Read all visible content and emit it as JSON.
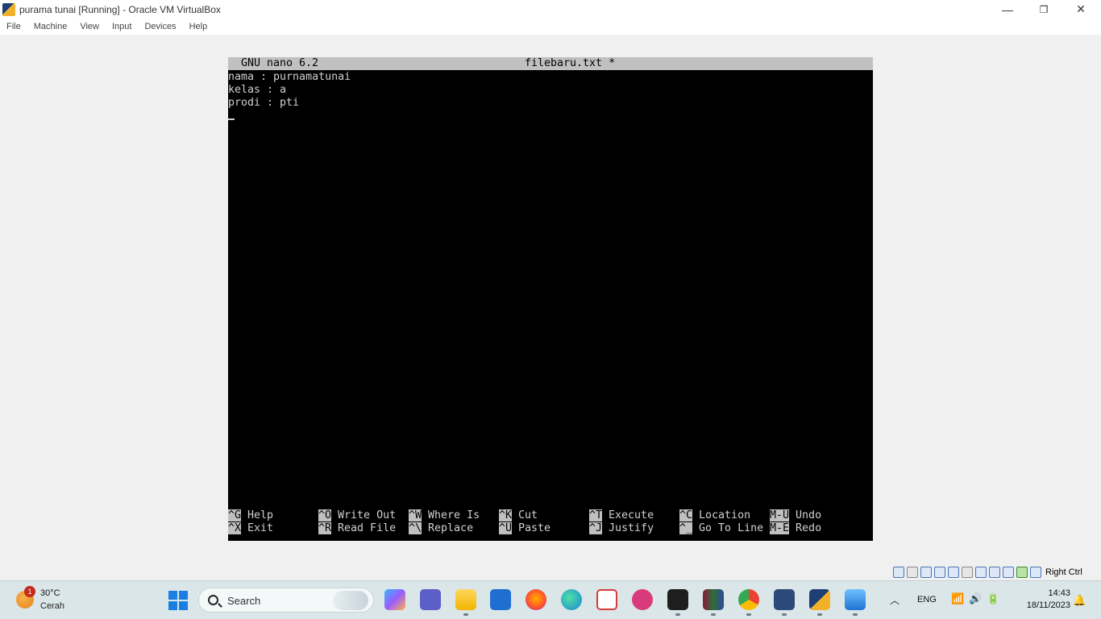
{
  "window": {
    "title": "purama tunai [Running] - Oracle VM VirtualBox",
    "minimize": "—",
    "restore": "❐",
    "close": "✕"
  },
  "menu": [
    "File",
    "Machine",
    "View",
    "Input",
    "Devices",
    "Help"
  ],
  "nano": {
    "version": "GNU nano 6.2",
    "filename": "filebaru.txt *",
    "lines": [
      "nama : purnamatunai",
      "kelas : a",
      "prodi : pti"
    ],
    "shortcuts": [
      {
        "key": "^G",
        "label": "Help"
      },
      {
        "key": "^X",
        "label": "Exit"
      },
      {
        "key": "^O",
        "label": "Write Out"
      },
      {
        "key": "^R",
        "label": "Read File"
      },
      {
        "key": "^W",
        "label": "Where Is"
      },
      {
        "key": "^\\",
        "label": "Replace"
      },
      {
        "key": "^K",
        "label": "Cut"
      },
      {
        "key": "^U",
        "label": "Paste"
      },
      {
        "key": "^T",
        "label": "Execute"
      },
      {
        "key": "^J",
        "label": "Justify"
      },
      {
        "key": "^C",
        "label": "Location"
      },
      {
        "key": "^_",
        "label": "Go To Line"
      },
      {
        "key": "M-U",
        "label": "Undo"
      },
      {
        "key": "M-E",
        "label": "Redo"
      }
    ]
  },
  "vbox_status": {
    "host_key": "Right Ctrl"
  },
  "taskbar": {
    "weather": {
      "badge": "1",
      "temp": "30°C",
      "condition": "Cerah"
    },
    "search_placeholder": "Search",
    "apps": [
      "copilot-pre",
      "teams",
      "file-explorer",
      "windows-app",
      "firefox",
      "edge",
      "snipping-tool",
      "wps-office",
      "terminal",
      "winrar",
      "chrome",
      "virtualbox",
      "virtualbox-vm",
      "photos"
    ],
    "language": "ENG",
    "time": "14:43",
    "date": "18/11/2023"
  },
  "colors": {
    "terminal_bg": "#000000",
    "terminal_fg": "#d0d0d0",
    "nano_bar": "#c0c0c0",
    "taskbar_bg": "#dbe6e9"
  }
}
